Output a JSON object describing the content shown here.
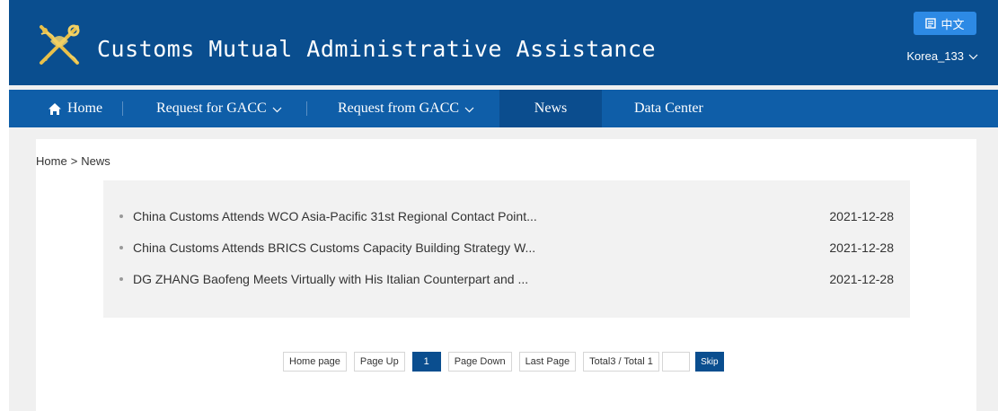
{
  "header": {
    "title": "Customs Mutual Administrative Assistance",
    "language_label": "中文",
    "user_name": "Korea_133"
  },
  "nav": {
    "items": [
      {
        "label": "Home",
        "icon": "home-icon"
      },
      {
        "label": "Request for GACC",
        "has_dropdown": true
      },
      {
        "label": "Request from GACC",
        "has_dropdown": true
      },
      {
        "label": "News",
        "active": true
      },
      {
        "label": "Data Center"
      }
    ]
  },
  "breadcrumb": {
    "home": "Home",
    "separator": ">",
    "current": "News"
  },
  "news": [
    {
      "title": "China Customs Attends WCO Asia-Pacific 31st Regional Contact Point...",
      "date": "2021-12-28"
    },
    {
      "title": "China Customs Attends BRICS Customs Capacity Building Strategy W...",
      "date": "2021-12-28"
    },
    {
      "title": "DG ZHANG Baofeng Meets Virtually with His Italian Counterpart and ...",
      "date": "2021-12-28"
    }
  ],
  "pagination": {
    "home_page": "Home page",
    "page_up": "Page Up",
    "current_page": "1",
    "page_down": "Page Down",
    "last_page": "Last Page",
    "total": "Total3 / Total 1",
    "jump_value": "",
    "skip": "Skip"
  },
  "colors": {
    "header_bg": "#0a4e8f",
    "nav_bg": "#0f5ea8",
    "nav_active_bg": "#0b4d8e",
    "lang_button_bg": "#2d8ae5",
    "page_bg": "#f0f0f0",
    "news_box_bg": "#f2f2f2"
  }
}
